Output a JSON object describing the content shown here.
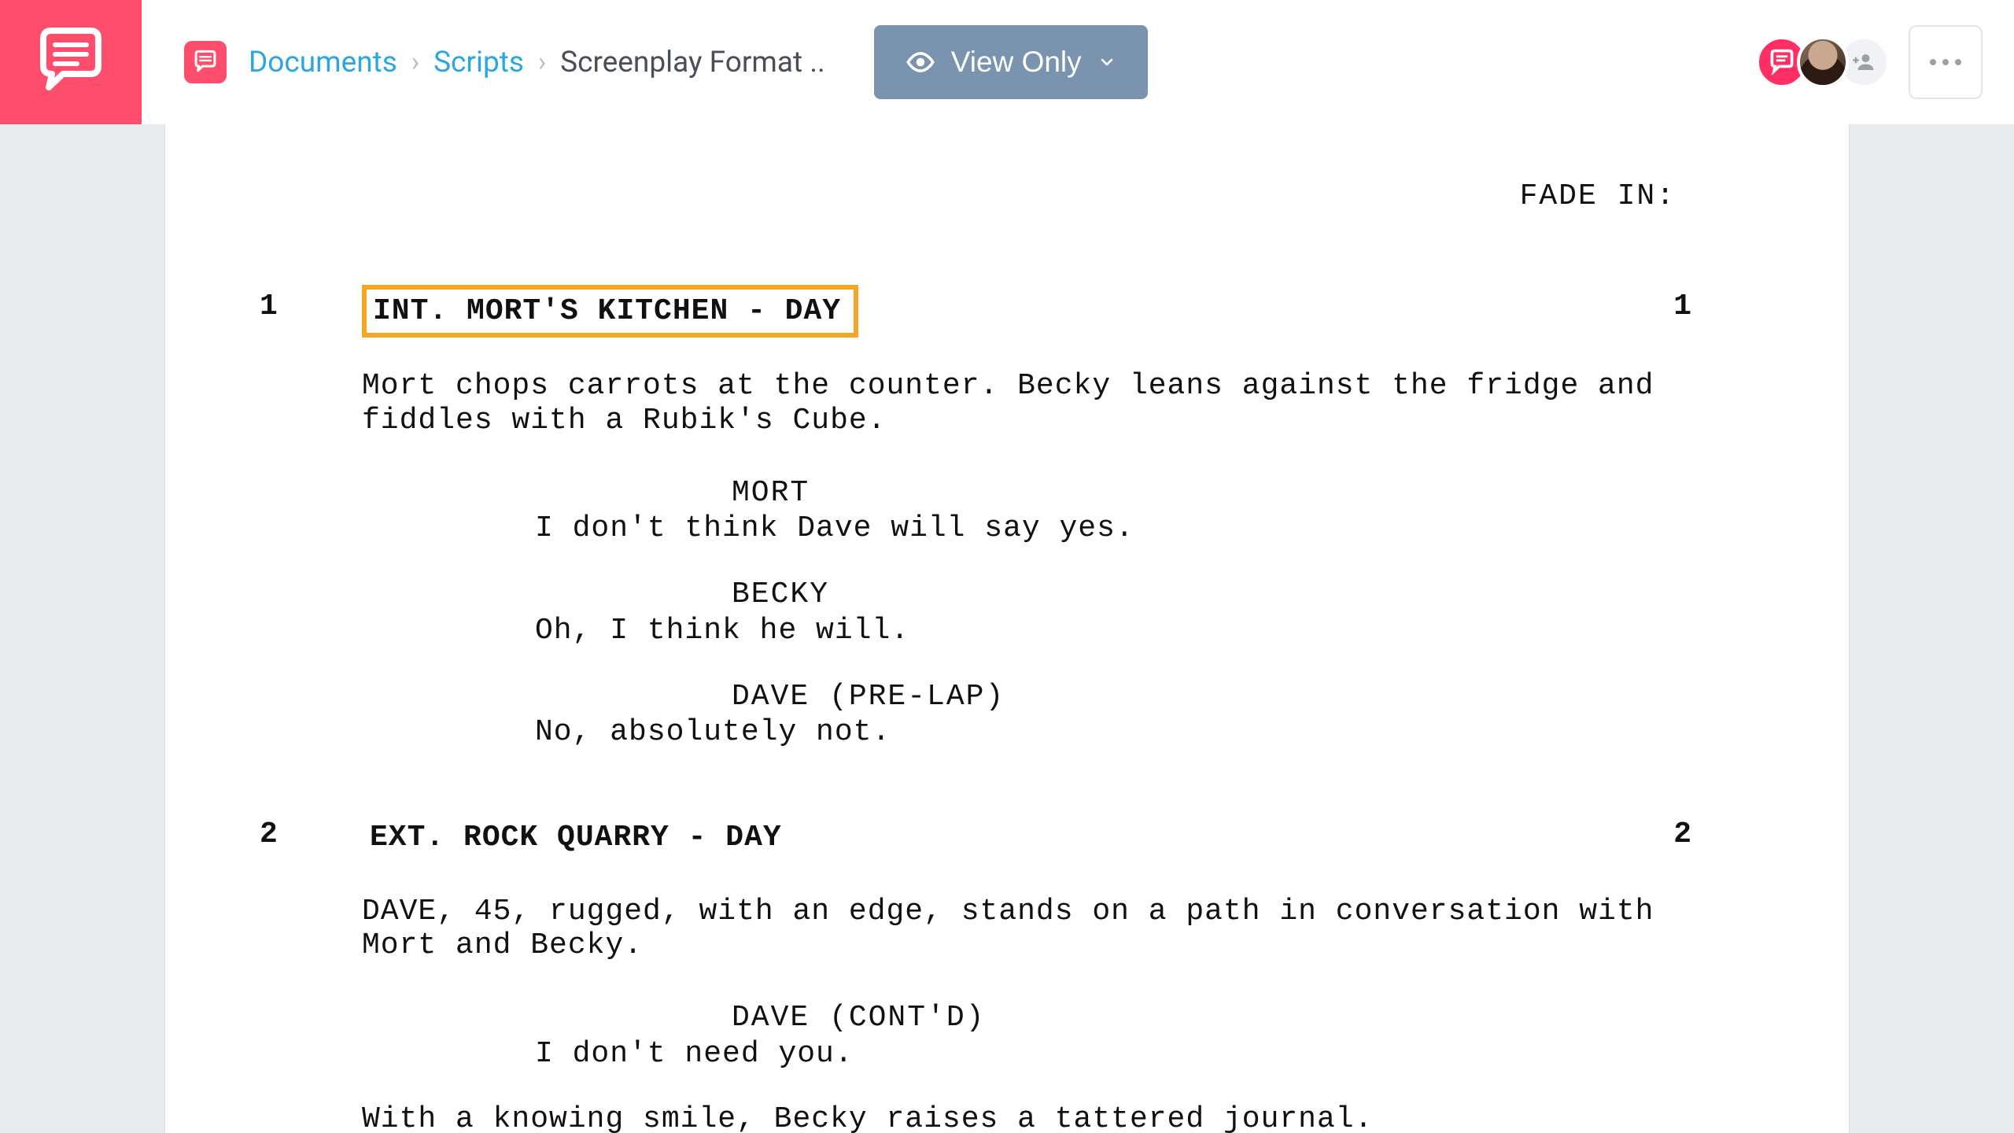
{
  "header": {
    "breadcrumbs": {
      "doc_root": "Documents",
      "scripts": "Scripts",
      "current": "Screenplay Format .."
    },
    "view_only_label": "View Only"
  },
  "script": {
    "fade_in": "FADE IN:",
    "scenes": [
      {
        "num": "1",
        "heading": "INT. MORT'S KITCHEN - DAY",
        "highlight": true,
        "action1": "Mort chops carrots at the counter. Becky leans against the fridge and fiddles with a Rubik's Cube.",
        "dialogues": [
          {
            "char": "MORT",
            "line": "I don't think Dave will say yes."
          },
          {
            "char": "BECKY",
            "line": "Oh, I think he will."
          },
          {
            "char": "DAVE (PRE-LAP)",
            "line": "No, absolutely not."
          }
        ]
      },
      {
        "num": "2",
        "heading": "EXT. ROCK QUARRY - DAY",
        "highlight": false,
        "action1": "DAVE, 45, rugged, with an edge, stands on a path in conversation with Mort and Becky.",
        "dialogues": [
          {
            "char": "DAVE (CONT'D)",
            "line": "I don't need you."
          }
        ],
        "action2": "With a knowing smile, Becky raises a tattered journal."
      }
    ]
  }
}
